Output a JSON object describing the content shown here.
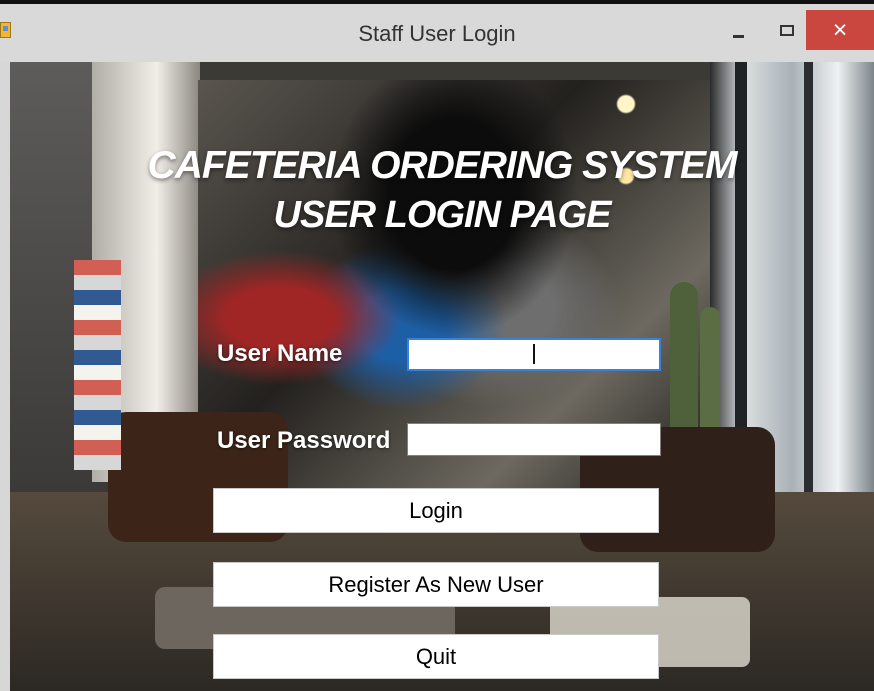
{
  "window": {
    "title": "Staff User Login",
    "icon": "app-icon"
  },
  "controls": {
    "minimize_icon": "minimize-icon",
    "maximize_icon": "maximize-icon",
    "close_icon": "close-icon",
    "close_symbol": "×"
  },
  "page": {
    "heading_line1": "CAFETERIA ORDERING SYSTEM",
    "heading_line2": "USER LOGIN PAGE"
  },
  "form": {
    "username_label": "User Name",
    "username_value": "",
    "password_label": "User Password",
    "password_value": ""
  },
  "buttons": {
    "login": "Login",
    "register": "Register As New User",
    "quit": "Quit"
  },
  "colors": {
    "close_button": "#c9473e",
    "input_focus_border": "#3a82d6"
  }
}
